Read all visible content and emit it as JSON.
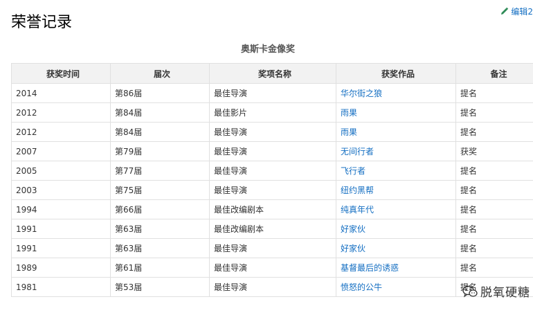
{
  "page": {
    "title": "荣誉记录"
  },
  "edit": {
    "label": "编辑2",
    "icon": "pencil-icon"
  },
  "table": {
    "caption": "奥斯卡金像奖",
    "headers": [
      "获奖时间",
      "届次",
      "奖项名称",
      "获奖作品",
      "备注"
    ],
    "rows": [
      [
        "2014",
        "第86届",
        "最佳导演",
        "华尔街之狼",
        "提名"
      ],
      [
        "2012",
        "第84届",
        "最佳影片",
        "雨果",
        "提名"
      ],
      [
        "2012",
        "第84届",
        "最佳导演",
        "雨果",
        "提名"
      ],
      [
        "2007",
        "第79届",
        "最佳导演",
        "无间行者",
        "获奖"
      ],
      [
        "2005",
        "第77届",
        "最佳导演",
        "飞行者",
        "提名"
      ],
      [
        "2003",
        "第75届",
        "最佳导演",
        "纽约黑帮",
        "提名"
      ],
      [
        "1994",
        "第66届",
        "最佳改编剧本",
        "纯真年代",
        "提名"
      ],
      [
        "1991",
        "第63届",
        "最佳改编剧本",
        "好家伙",
        "提名"
      ],
      [
        "1991",
        "第63届",
        "最佳导演",
        "好家伙",
        "提名"
      ],
      [
        "1989",
        "第61届",
        "最佳导演",
        "基督最后的诱惑",
        "提名"
      ],
      [
        "1981",
        "第53届",
        "最佳导演",
        "愤怒的公牛",
        "提名"
      ]
    ]
  },
  "watermark": {
    "text": "脱氧硬糖",
    "icon": "wechat-icon"
  },
  "colors": {
    "link": "#136ec2",
    "header_bg": "#f2f2f2",
    "border": "#e0e0e0"
  }
}
